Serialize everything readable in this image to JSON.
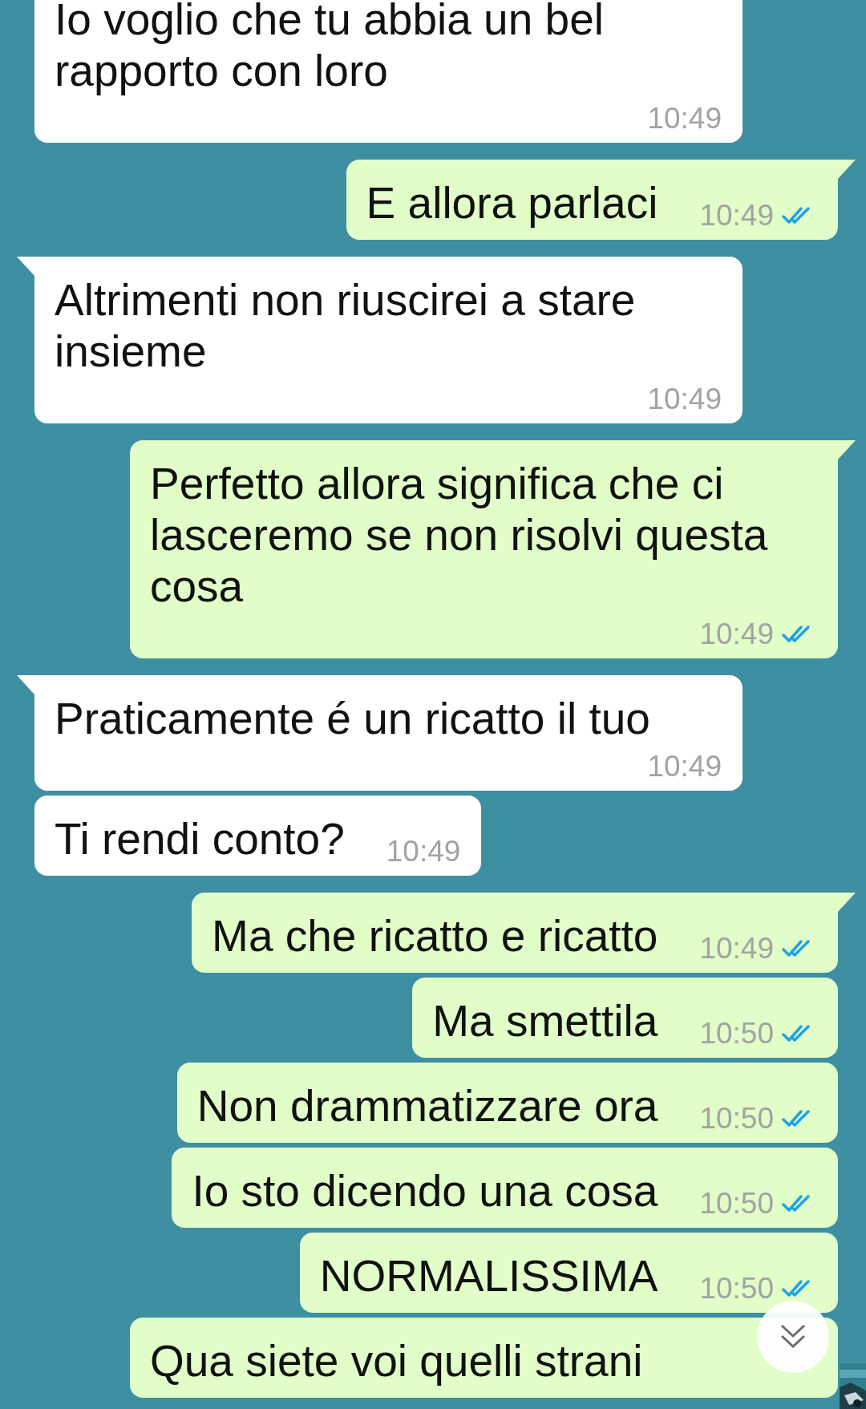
{
  "messages": [
    {
      "outgoing": false,
      "text": "Io voglio che tu abbia un bel rapporto con loro",
      "time": "10:49"
    },
    {
      "outgoing": true,
      "text": "E allora parlaci",
      "time": "10:49",
      "tail": true,
      "read": true
    },
    {
      "outgoing": false,
      "text": "Altrimenti non riuscirei a stare insieme",
      "time": "10:49",
      "tail": true
    },
    {
      "outgoing": true,
      "text": "Perfetto allora significa che ci lasceremo se non risolvi questa cosa",
      "time": "10:49",
      "tail": true,
      "read": true
    },
    {
      "outgoing": false,
      "text": "Praticamente é un ricatto il tuo",
      "time": "10:49",
      "tail": true
    },
    {
      "outgoing": false,
      "text": "Ti rendi conto?",
      "time": "10:49",
      "tail": false
    },
    {
      "outgoing": true,
      "text": "Ma che ricatto e ricatto",
      "time": "10:49",
      "tail": true,
      "read": true
    },
    {
      "outgoing": true,
      "text": "Ma smettila",
      "time": "10:50",
      "tail": false,
      "read": true
    },
    {
      "outgoing": true,
      "text": "Non drammatizzare ora",
      "time": "10:50",
      "tail": false,
      "read": true
    },
    {
      "outgoing": true,
      "text": "Io sto dicendo una cosa",
      "time": "10:50",
      "tail": false,
      "read": true
    },
    {
      "outgoing": true,
      "text": "NORMALISSIMA",
      "time": "10:50",
      "tail": false,
      "read": true
    },
    {
      "outgoing": true,
      "text": "Qua siete voi quelli strani",
      "tail": false
    }
  ]
}
